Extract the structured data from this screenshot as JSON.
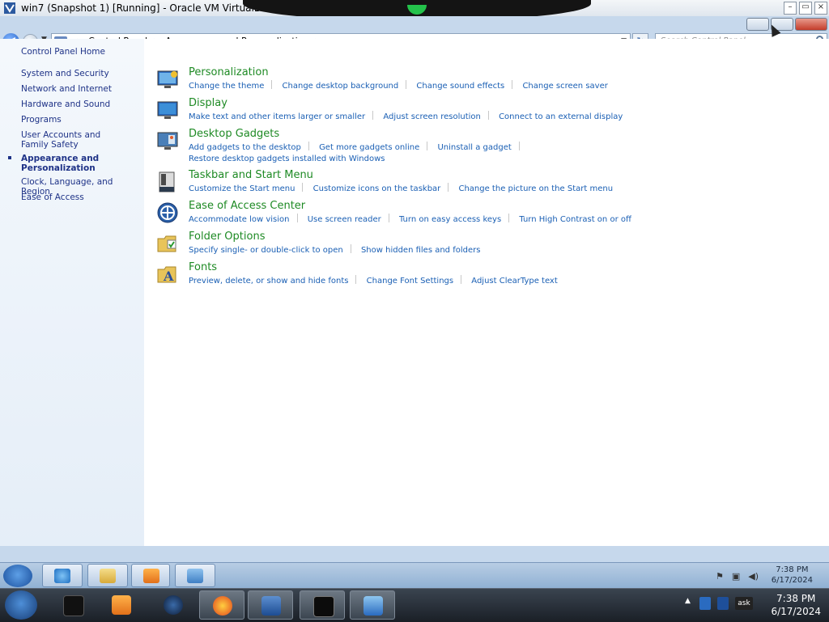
{
  "host_window": {
    "title": "win7 (Snapshot 1) [Running] - Oracle VM VirtualBox"
  },
  "address_bar": {
    "crumbs": [
      "Control Panel",
      "Appearance and Personalization"
    ],
    "search_placeholder": "Search Control Panel"
  },
  "left_pane": {
    "home": "Control Panel Home",
    "items": [
      "System and Security",
      "Network and Internet",
      "Hardware and Sound",
      "Programs",
      "User Accounts and Family Safety",
      "Appearance and Personalization",
      "Clock, Language, and Region",
      "Ease of Access"
    ],
    "active_item": "Appearance and Personalization"
  },
  "categories": [
    {
      "title": "Personalization",
      "icon": "personalization-icon",
      "links": [
        "Change the theme",
        "Change desktop background",
        "Change sound effects",
        "Change screen saver"
      ]
    },
    {
      "title": "Display",
      "icon": "display-icon",
      "links": [
        "Make text and other items larger or smaller",
        "Adjust screen resolution",
        "Connect to an external display"
      ]
    },
    {
      "title": "Desktop Gadgets",
      "icon": "desktop-gadgets-icon",
      "links": [
        "Add gadgets to the desktop",
        "Get more gadgets online",
        "Uninstall a gadget",
        "Restore desktop gadgets installed with Windows"
      ]
    },
    {
      "title": "Taskbar and Start Menu",
      "icon": "taskbar-icon",
      "links": [
        "Customize the Start menu",
        "Customize icons on the taskbar",
        "Change the picture on the Start menu"
      ]
    },
    {
      "title": "Ease of Access Center",
      "icon": "ease-of-access-icon",
      "links": [
        "Accommodate low vision",
        "Use screen reader",
        "Turn on easy access keys",
        "Turn High Contrast on or off"
      ]
    },
    {
      "title": "Folder Options",
      "icon": "folder-options-icon",
      "links": [
        "Specify single- or double-click to open",
        "Show hidden files and folders"
      ]
    },
    {
      "title": "Fonts",
      "icon": "fonts-icon",
      "links": [
        "Preview, delete, or show and hide fonts",
        "Change Font Settings",
        "Adjust ClearType text"
      ]
    }
  ],
  "guest_taskbar": {
    "time": "7:38 PM",
    "date": "6/17/2024"
  },
  "host_taskbar": {
    "time": "7:38 PM",
    "date": "6/17/2024",
    "tray_label": "ask"
  },
  "colors": {
    "category_title": "#1e8a24",
    "link": "#1a5fb4",
    "left_pane_text": "#1e3287"
  }
}
